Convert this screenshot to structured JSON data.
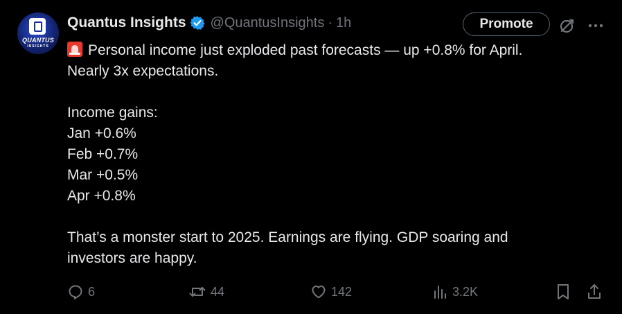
{
  "author": {
    "display_name": "Quantus Insights",
    "handle": "@QuantusInsights",
    "separator": "·",
    "timestamp": "1h",
    "avatar_text": "QUANTUS",
    "avatar_subtext": "INSIGHTS"
  },
  "header_actions": {
    "promote_label": "Promote"
  },
  "icons": {
    "verified": "verified-badge-icon",
    "grok": "grok-icon",
    "more": "more-icon",
    "alert": "rotating-light-emoji",
    "reply": "reply-icon",
    "repost": "repost-icon",
    "like": "heart-icon",
    "views": "views-icon",
    "bookmark": "bookmark-icon",
    "share": "share-icon"
  },
  "colors": {
    "background": "#000000",
    "text": "#e7e9ea",
    "muted": "#71767b",
    "verified": "#1d9bf0",
    "avatar": "#1b2f9a"
  },
  "tweet": {
    "line1": "Personal income just exploded past forecasts — up +0.8% for April.",
    "line2": "Nearly 3x expectations.",
    "gains_heading": "Income gains:",
    "gains": [
      "Jan +0.6%",
      "Feb +0.7%",
      "Mar +0.5%",
      "Apr +0.8%"
    ],
    "closing_line1": "That’s a monster start to 2025. Earnings are flying. GDP soaring and",
    "closing_line2": "investors are happy."
  },
  "engagement": {
    "replies": "6",
    "reposts": "44",
    "likes": "142",
    "views": "3.2K"
  }
}
